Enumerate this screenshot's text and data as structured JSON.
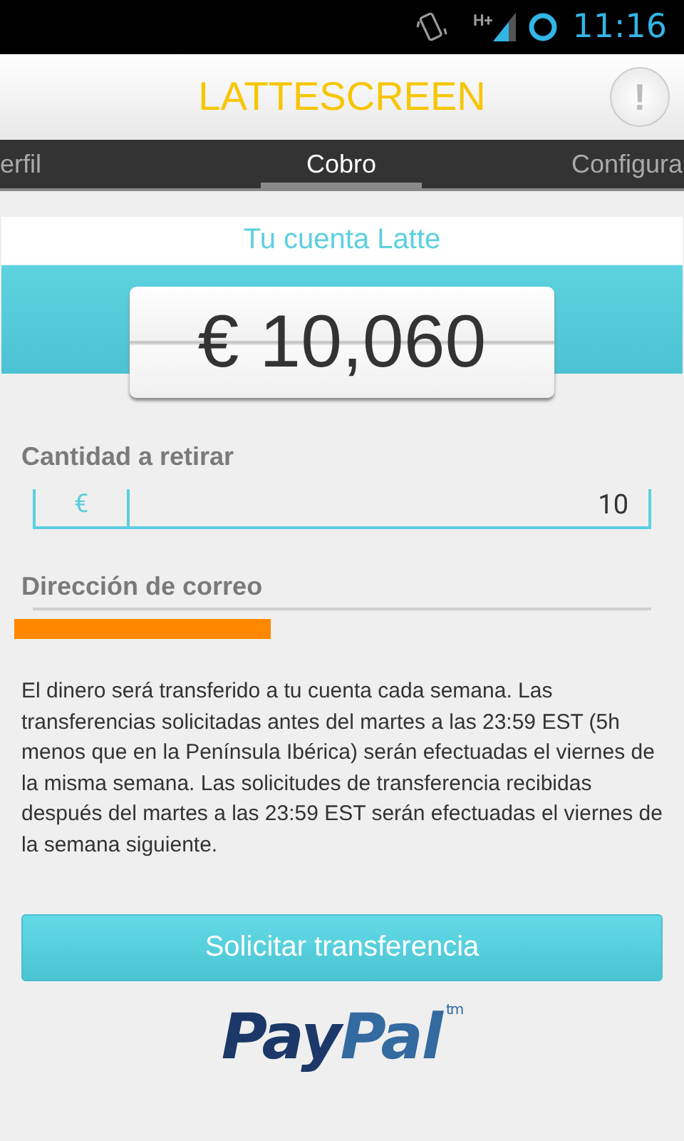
{
  "status_bar": {
    "network": "H+",
    "time": "11:16"
  },
  "action_bar": {
    "title": "LATTESCREEN",
    "alert_button": "!"
  },
  "tabs": [
    {
      "label": "erfil",
      "selected": false
    },
    {
      "label": "Cobro",
      "selected": true
    },
    {
      "label": "Configura",
      "selected": false
    }
  ],
  "account": {
    "title": "Tu cuenta Latte",
    "balance": "€ 10,060"
  },
  "amount_field": {
    "label": "Cantidad a retirar",
    "currency": "€",
    "value": "10"
  },
  "email_field": {
    "label": "Dirección de correo",
    "redacted": true
  },
  "notice": "El dinero será transferido a tu cuenta cada semana. Las transferencias solicitadas antes del martes a las 23:59 EST (5h menos que en la Península Ibérica) serán efectuadas el viernes de la misma semana. Las solicitudes de transferencia recibidas después del martes a las 23:59 EST serán efectuadas el viernes de la semana siguiente.",
  "submit_button": "Solicitar transferencia",
  "logo": {
    "parts": [
      "Pay",
      "Pal"
    ],
    "mark": "tm"
  }
}
